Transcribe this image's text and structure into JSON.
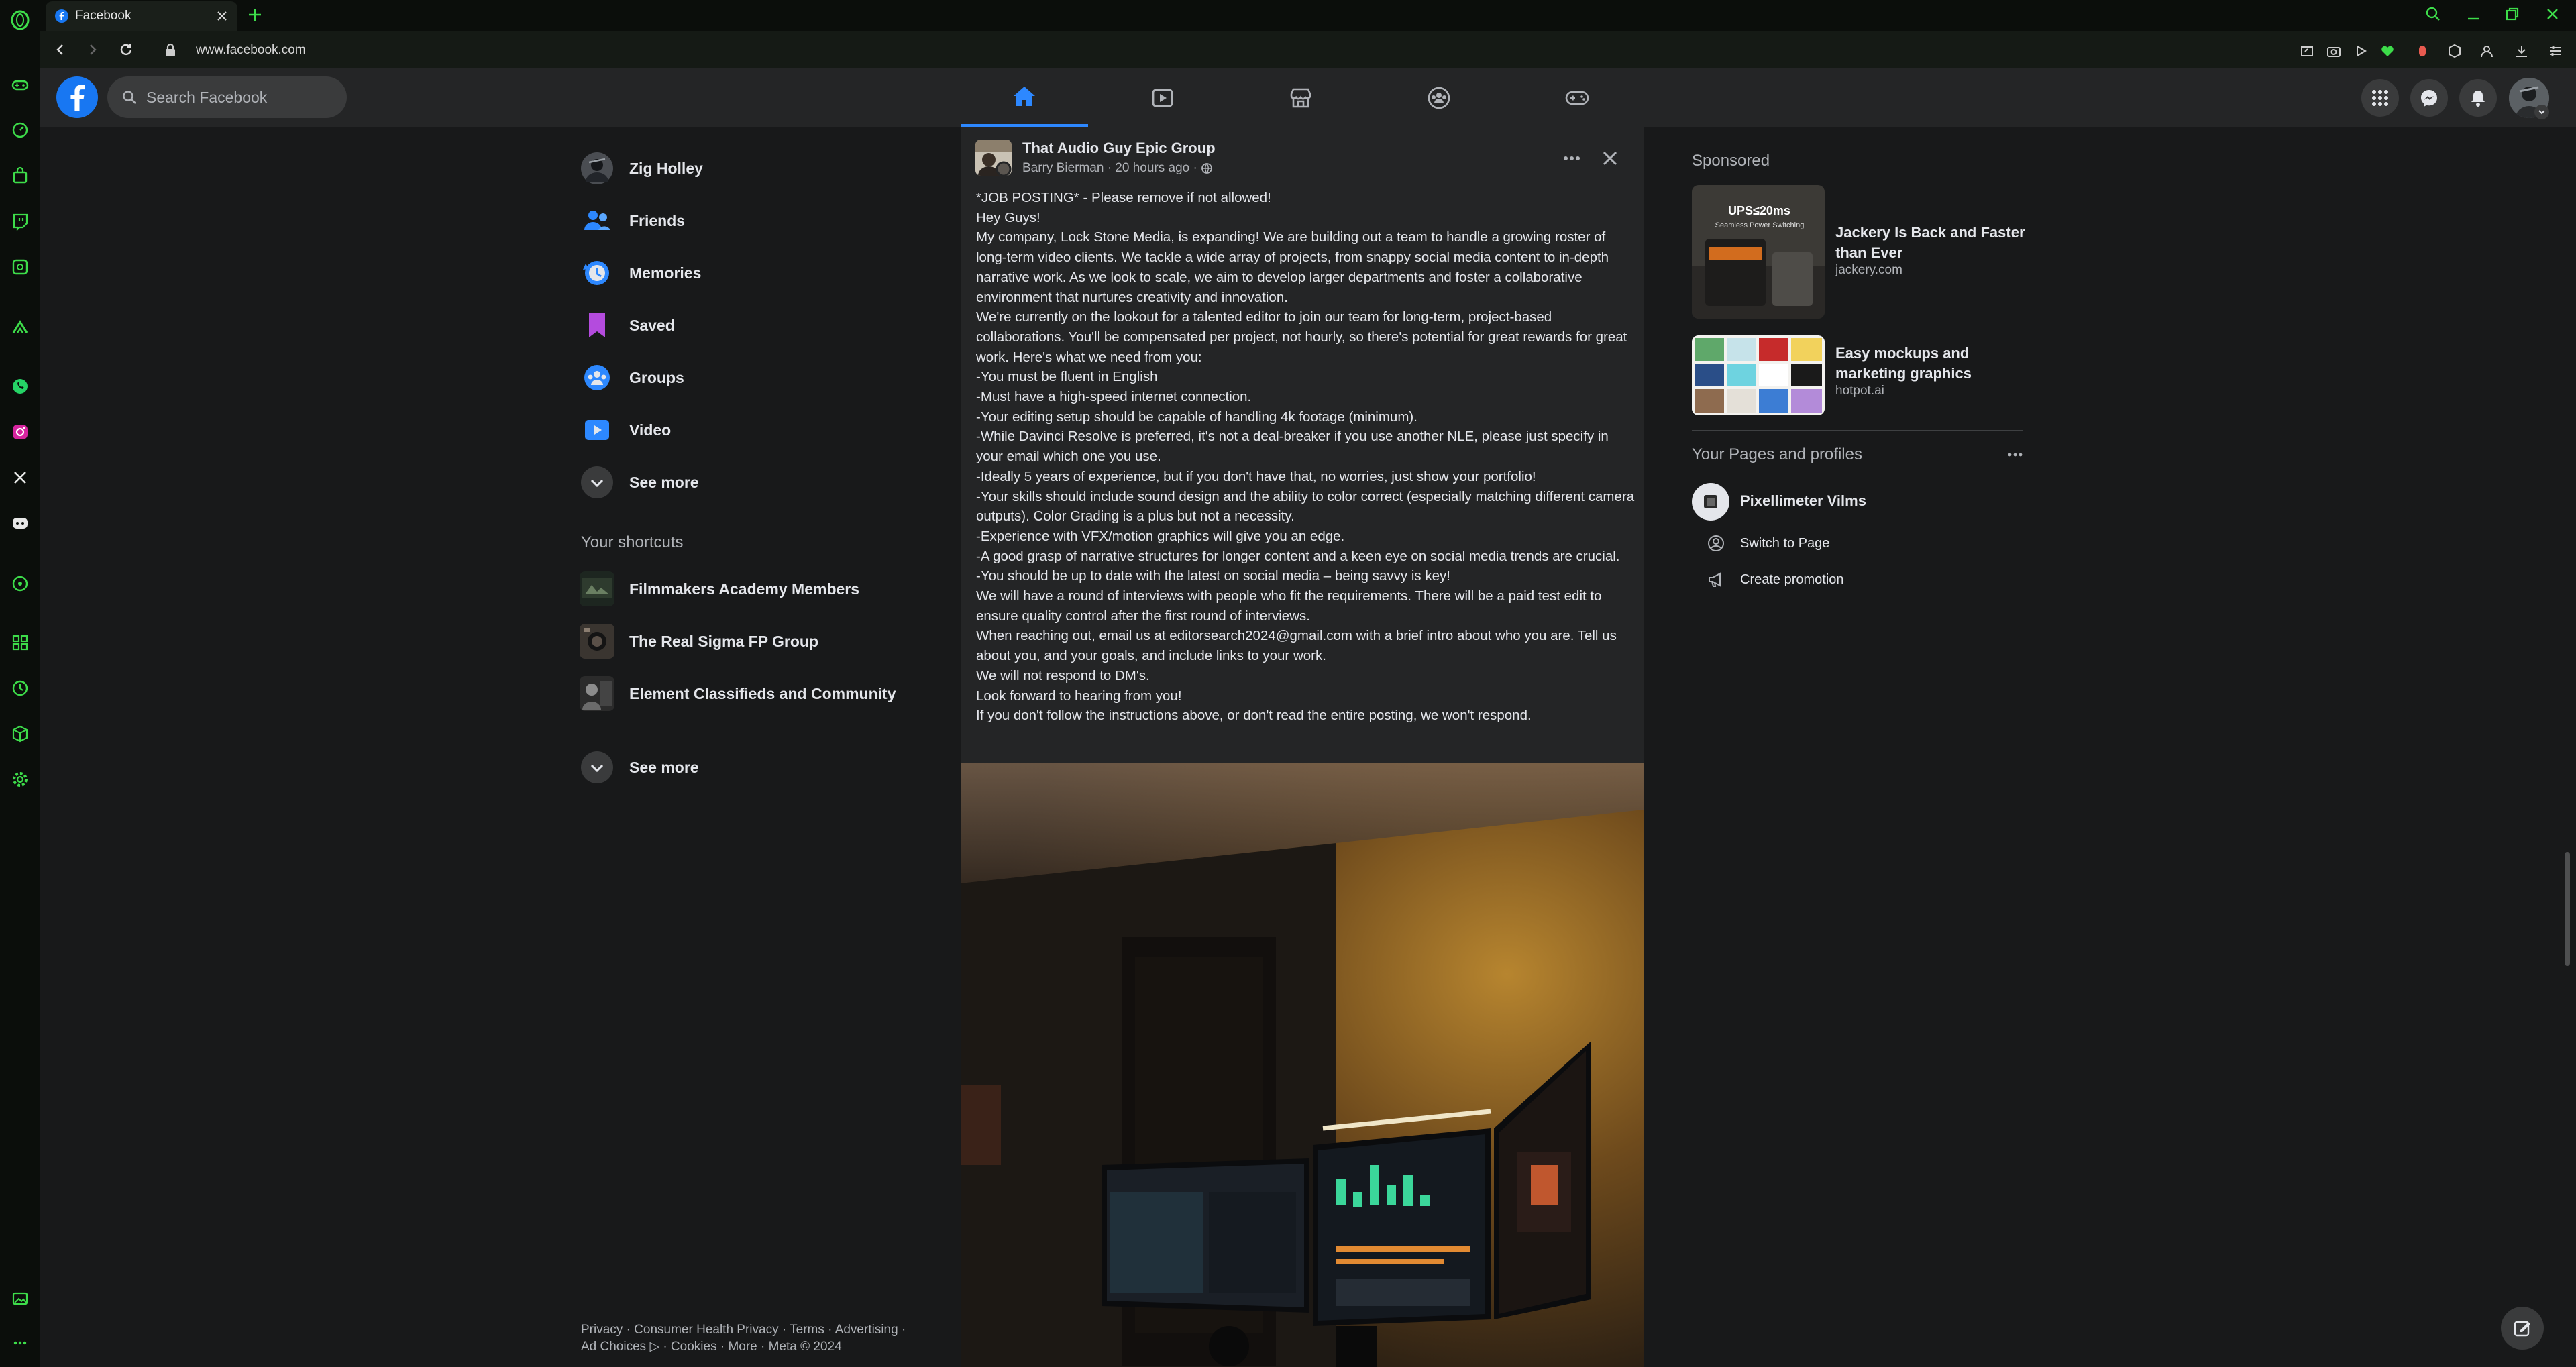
{
  "browser": {
    "tab_title": "Facebook",
    "url": "www.facebook.com"
  },
  "header": {
    "search_placeholder": "Search Facebook"
  },
  "left_nav": {
    "items": [
      {
        "label": "Zig Holley",
        "icon": "avatar"
      },
      {
        "label": "Friends",
        "icon": "friends-icon"
      },
      {
        "label": "Memories",
        "icon": "memories-icon"
      },
      {
        "label": "Saved",
        "icon": "saved-icon"
      },
      {
        "label": "Groups",
        "icon": "groups-icon"
      },
      {
        "label": "Video",
        "icon": "video-icon"
      }
    ],
    "see_more": "See more",
    "shortcuts_title": "Your shortcuts",
    "shortcuts": [
      {
        "label": "Filmmakers Academy Members"
      },
      {
        "label": "The Real Sigma FP Group"
      },
      {
        "label": "Element Classifieds and Community"
      }
    ],
    "shortcuts_see_more": "See more"
  },
  "footer": {
    "line1": "Privacy · Consumer Health Privacy · Terms · Advertising ·",
    "line2": "Ad Choices ▷ · Cookies · More · Meta © 2024"
  },
  "post": {
    "group": "That Audio Guy Epic Group",
    "author": "Barry Bierman",
    "time": " · 20 hours ago · ",
    "lines": [
      "*JOB POSTING* - Please remove if not allowed!",
      "Hey Guys!",
      "My company, Lock Stone Media, is expanding! We are building out a team to handle a growing roster of long-term video clients. We tackle a wide array of projects, from snappy social media content to in-depth narrative work. As we look to scale, we aim to develop larger departments and foster a collaborative environment that nurtures creativity and innovation.",
      "We're currently on the lookout for a talented editor to join our team for long-term, project-based collaborations. You'll be compensated per project, not hourly, so there's potential for great rewards for great work. Here's what we need from you:",
      "-You must be fluent in English",
      "-Must have a high-speed internet connection.",
      "-Your editing setup should be capable of handling 4k footage (minimum).",
      "-While Davinci Resolve is preferred, it's not a deal-breaker if you use another NLE, please just specify in your email which one you use.",
      "-Ideally 5 years of experience, but if you don't have that, no worries, just show your portfolio!",
      "-Your skills should include sound design and the ability to color correct (especially matching different camera outputs). Color Grading is a plus but not a necessity.",
      "-Experience with VFX/motion graphics will give you an edge.",
      "-A good grasp of narrative structures for longer content and a keen eye on social media trends are crucial.",
      "-You should be up to date with the latest on social media – being savvy is key!",
      "We will have a round of interviews with people who fit the requirements. There will be a paid test edit to ensure quality control after the first round of interviews.",
      "When reaching out, email us at editorsearch2024@gmail.com with a brief intro about who you are. Tell us about you, and your goals, and include links to your work.",
      "We will not respond to DM's.",
      "Look forward to hearing from you!",
      "If you don't follow the instructions above, or don't read the entire posting, we won't respond."
    ]
  },
  "sponsored": {
    "title": "Sponsored",
    "ads": [
      {
        "title": "Jackery Is Back and Faster than Ever",
        "domain": "jackery.com",
        "thumb_text": "UPS≤20ms",
        "thumb_sub": "Seamless Power Switching"
      },
      {
        "title": "Easy mockups and marketing graphics",
        "domain": "hotpot.ai"
      }
    ]
  },
  "pages": {
    "title": "Your Pages and profiles",
    "page_name": "Pixellimeter Vilms",
    "actions": [
      "Switch to Page",
      "Create promotion"
    ]
  },
  "colors": {
    "accent": "#2d88ff",
    "browser_accent": "#3ddc4a",
    "background": "#18191a",
    "card": "#242526"
  }
}
